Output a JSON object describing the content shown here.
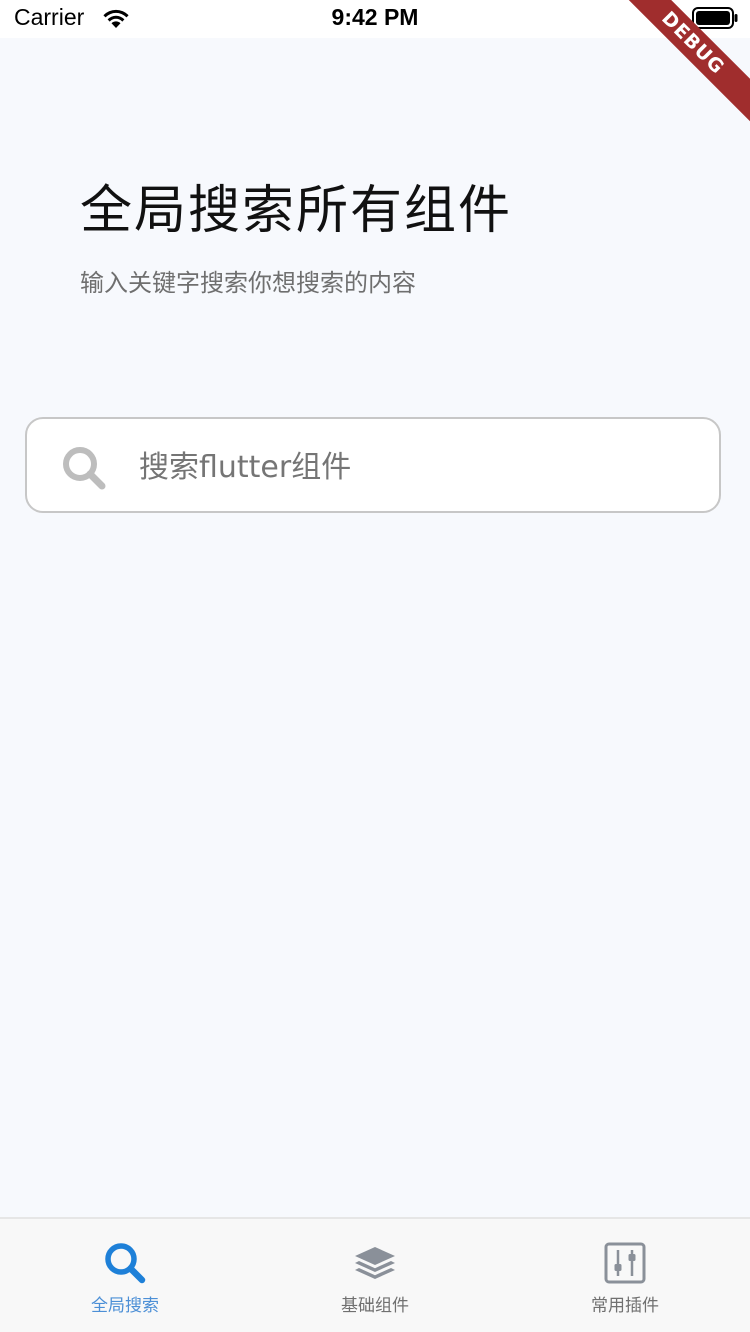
{
  "status_bar": {
    "carrier": "Carrier",
    "time": "9:42 PM"
  },
  "debug_banner": "DEBUG",
  "header": {
    "title": "全局搜索所有组件",
    "subtitle": "输入关键字搜索你想搜索的内容"
  },
  "search": {
    "placeholder": "搜索flutter组件",
    "value": ""
  },
  "bottom_nav": {
    "items": [
      {
        "label": "全局搜索",
        "icon": "search-icon",
        "active": true
      },
      {
        "label": "基础组件",
        "icon": "layers-icon",
        "active": false
      },
      {
        "label": "常用插件",
        "icon": "sliders-icon",
        "active": false
      }
    ]
  },
  "colors": {
    "background": "#f7f9fd",
    "accent": "#1e80d8",
    "inactive_icon": "#8a9099",
    "debug": "#a02d2d"
  }
}
